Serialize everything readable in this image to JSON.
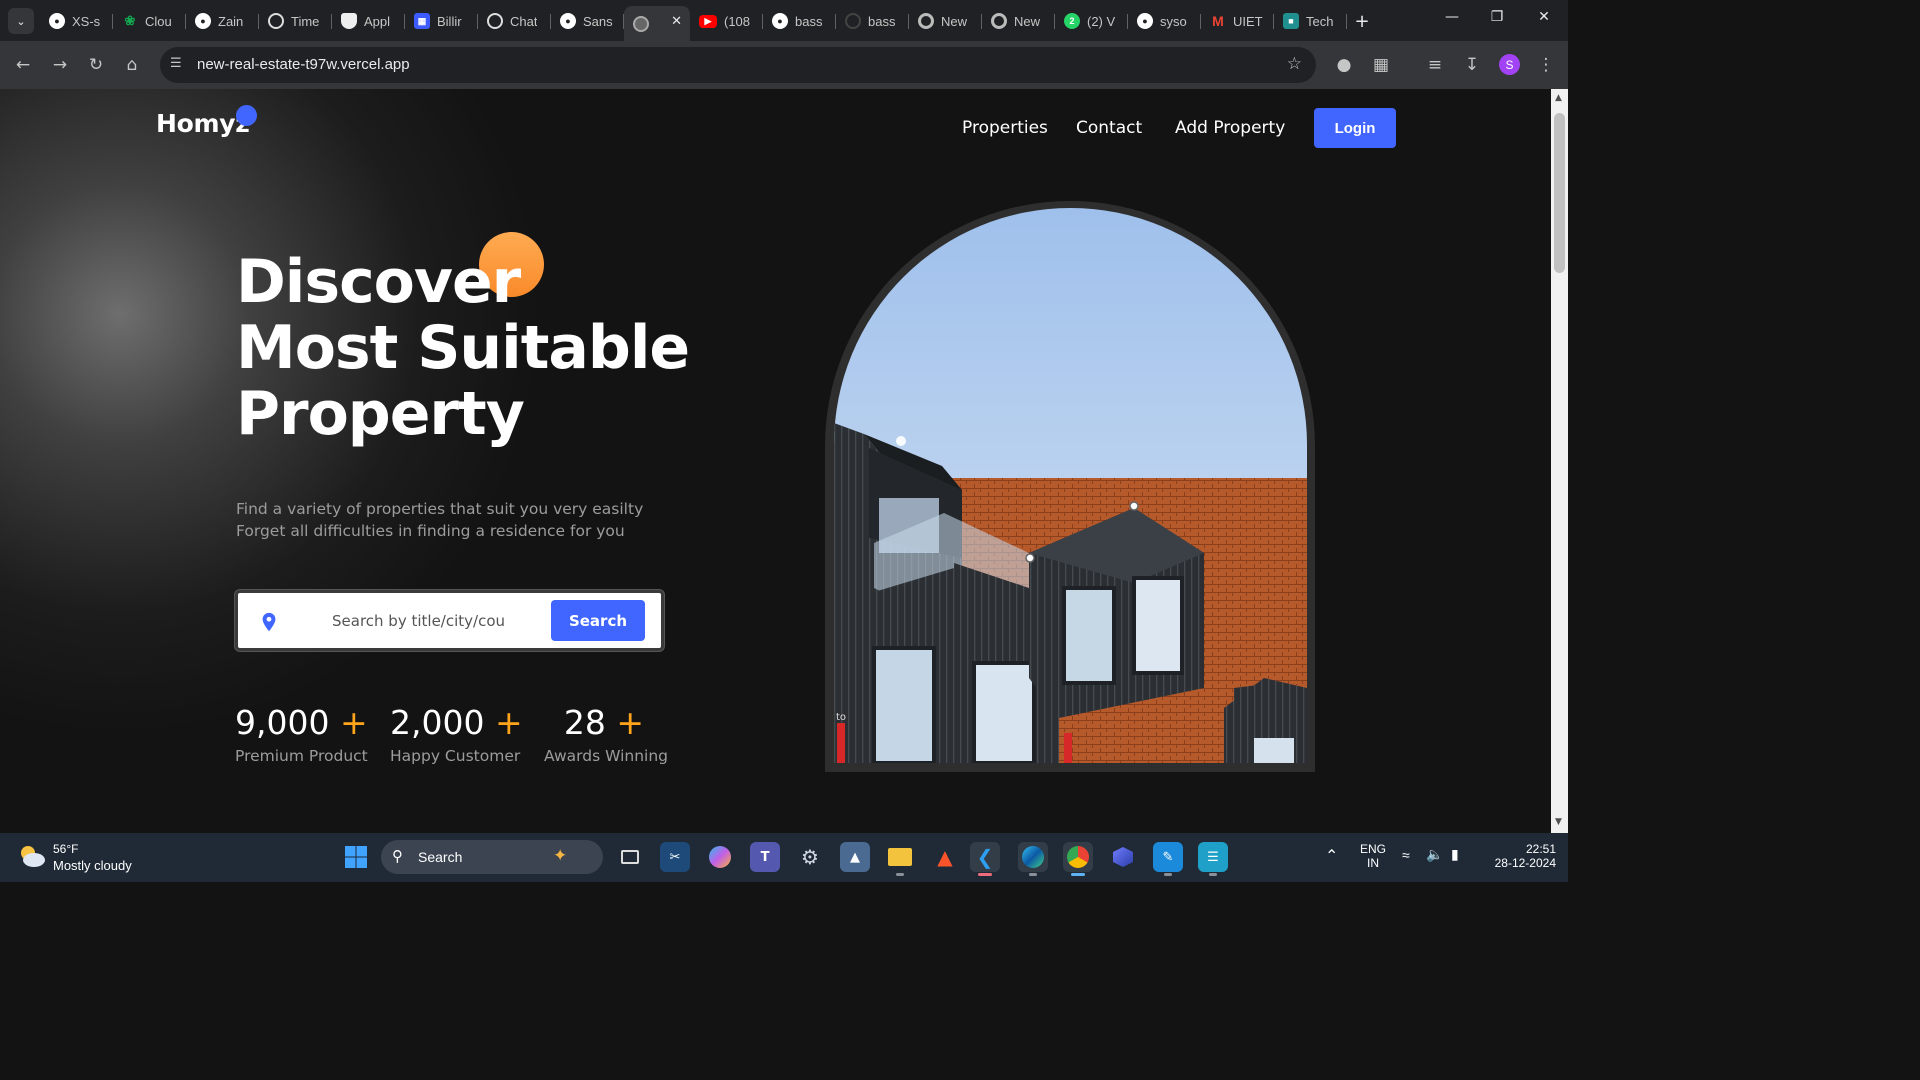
{
  "browser": {
    "tabs": [
      {
        "label": "XS-s",
        "icon": "github-icon",
        "color": "#ffffff"
      },
      {
        "label": "Clou",
        "icon": "mongodb-icon",
        "color": "#13aa52"
      },
      {
        "label": "Zain",
        "icon": "github-icon",
        "color": "#ffffff"
      },
      {
        "label": "Time",
        "icon": "openai-icon",
        "color": "#ffffff"
      },
      {
        "label": "Appl",
        "icon": "shield-icon",
        "color": "#ffffff"
      },
      {
        "label": "Billir",
        "icon": "bank-icon",
        "color": "#3d5afe"
      },
      {
        "label": "Chat",
        "icon": "openai-icon",
        "color": "#ffffff"
      },
      {
        "label": "Sans",
        "icon": "github-icon",
        "color": "#ffffff"
      },
      {
        "label": "",
        "icon": "globe-icon",
        "color": "#aaaaaa",
        "active": true
      },
      {
        "label": "(108",
        "icon": "youtube-icon",
        "color": "#ff0000"
      },
      {
        "label": "bass",
        "icon": "github-icon",
        "color": "#ffffff"
      },
      {
        "label": "bass",
        "icon": "loading-icon",
        "color": "#555555"
      },
      {
        "label": "New",
        "icon": "chrome-icon",
        "color": "#bbbbbb"
      },
      {
        "label": "New",
        "icon": "chrome-icon",
        "color": "#bbbbbb"
      },
      {
        "label": "(2) V",
        "icon": "whatsapp-icon",
        "color": "#25d366",
        "badge": "2"
      },
      {
        "label": "syso",
        "icon": "github-icon",
        "color": "#ffffff"
      },
      {
        "label": "UIET",
        "icon": "gmail-icon",
        "color": "#ea4335"
      },
      {
        "label": "Tech",
        "icon": "teams-icon",
        "color": "#1f8f8f"
      }
    ],
    "url": "new-real-estate-t97w.vercel.app",
    "profile_initial": "S"
  },
  "site": {
    "logo": "Homyz",
    "nav": {
      "properties": "Properties",
      "contact": "Contact",
      "add_property": "Add Property",
      "login": "Login"
    },
    "hero": {
      "title_line1": "Discover",
      "title_line2": "Most Suitable",
      "title_line3": "Property",
      "sub_line1": "Find a variety of properties that suit you very easilty",
      "sub_line2": "Forget all difficulties in finding a residence for you"
    },
    "search": {
      "placeholder": "Search by title/city/country",
      "button": "Search"
    },
    "stats": [
      {
        "value": "9,000",
        "plus": "+",
        "label": "Premium Product"
      },
      {
        "value": "2,000",
        "plus": "+",
        "label": "Happy Customer"
      },
      {
        "value": "28",
        "plus": "+",
        "label": "Awards Winning"
      }
    ],
    "photo_caption": "to",
    "colors": {
      "accent": "#4066ff",
      "orange": "#ffa41b",
      "background": "#131313"
    }
  },
  "taskbar": {
    "weather": {
      "temp": "56°F",
      "desc": "Mostly cloudy"
    },
    "search_label": "Search",
    "lang_line1": "ENG",
    "lang_line2": "IN",
    "time": "22:51",
    "date": "28-12-2024"
  }
}
